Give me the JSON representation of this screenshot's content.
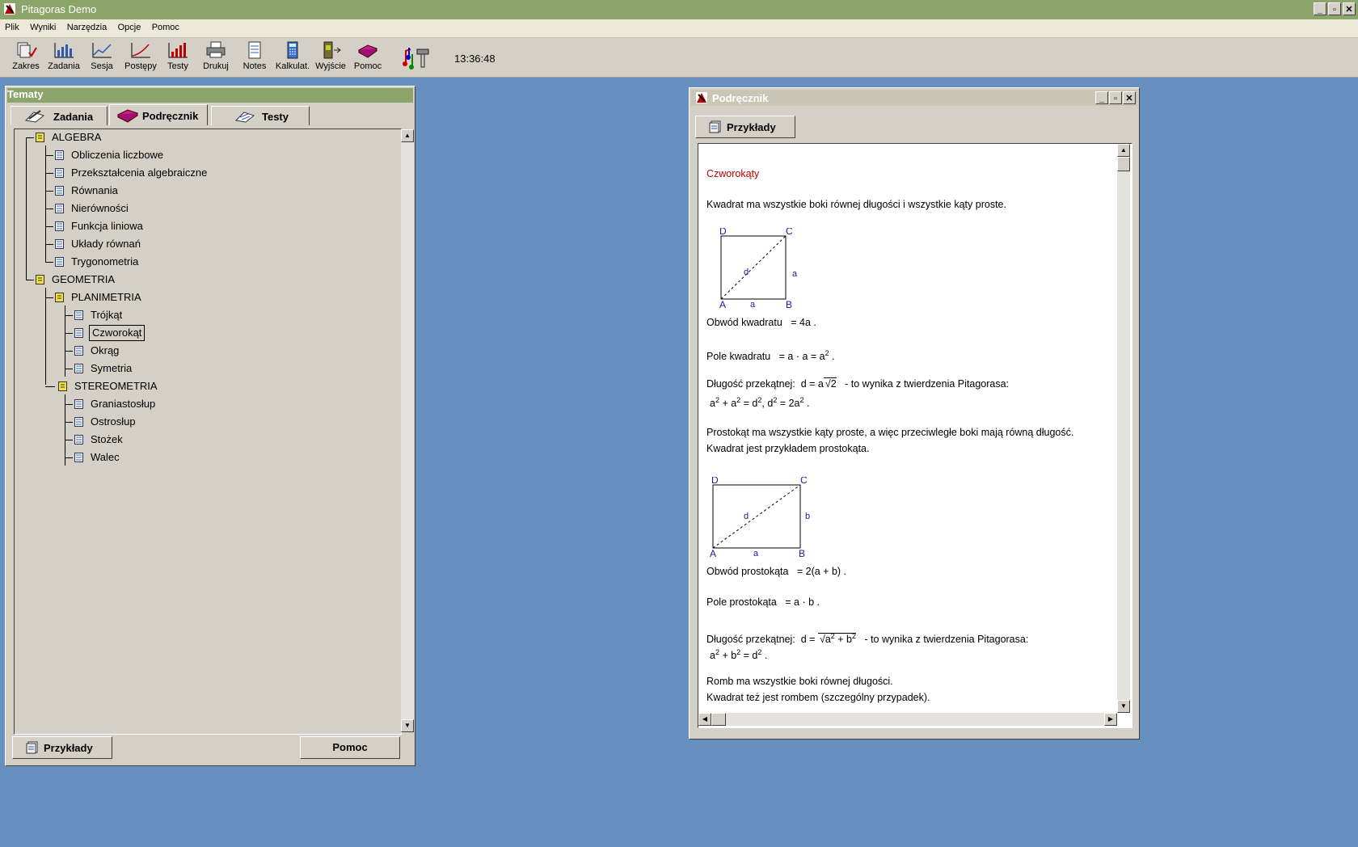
{
  "app": {
    "title": "Pitagoras Demo",
    "window_controls": [
      "_",
      "▫",
      "✕"
    ]
  },
  "menu": [
    "Plik",
    "Wyniki",
    "Narzędzia",
    "Opcje",
    "Pomoc"
  ],
  "toolbar": {
    "buttons": [
      {
        "label": "Zakres",
        "icon": "scope-icon"
      },
      {
        "label": "Zadania",
        "icon": "tasks-bar-chart-icon"
      },
      {
        "label": "Sesja",
        "icon": "session-line-chart-icon"
      },
      {
        "label": "Postępy",
        "icon": "progress-chart-icon"
      },
      {
        "label": "Testy",
        "icon": "tests-bar-chart-icon"
      },
      {
        "label": "Drukuj",
        "icon": "printer-icon"
      },
      {
        "label": "Notes",
        "icon": "notepad-icon"
      },
      {
        "label": "Kalkulat.",
        "icon": "calculator-icon"
      },
      {
        "label": "Wyjście",
        "icon": "exit-door-icon"
      },
      {
        "label": "Pomoc",
        "icon": "help-book-icon"
      }
    ],
    "clock": "13:36:48"
  },
  "tematy": {
    "title": "Tematy",
    "tabs": [
      "Zadania",
      "Podręcznik",
      "Testy"
    ],
    "active_tab": "Podręcznik",
    "tree": {
      "algebra": "ALGEBRA",
      "algebra_items": [
        "Obliczenia liczbowe",
        "Przekształcenia algebraiczne",
        "Równania",
        "Nierówności",
        "Funkcja liniowa",
        "Układy równań",
        "Trygonometria"
      ],
      "geometria": "GEOMETRIA",
      "planimetria": "PLANIMETRIA",
      "planimetria_items": [
        "Trójkąt",
        "Czworokąt",
        "Okrąg",
        "Symetria"
      ],
      "stereometria": "STEREOMETRIA",
      "stereometria_items": [
        "Graniastosłup",
        "Ostrosłup",
        "Stożek",
        "Walec"
      ],
      "selected": "Czworokąt"
    },
    "buttons": {
      "examples": "Przykłady",
      "help": "Pomoc"
    }
  },
  "podrecznik": {
    "title": "Podręcznik",
    "examples_button": "Przykłady",
    "heading": "Czworokąty",
    "p1": "Kwadrat ma wszystkie boki równej długości i wszystkie kąty proste.",
    "square_labels": {
      "D": "D",
      "C": "C",
      "A": "A",
      "B": "B",
      "d": "d",
      "a_side": "a",
      "a_bottom": "a"
    },
    "obwod_kw_label": "Obwód kwadratu",
    "obwod_kw_formula": "= 4a .",
    "pole_kw_label": "Pole kwadratu",
    "pole_kw_formula_a": "= a · a = a",
    "pole_kw_formula_exp": "2",
    "pole_kw_formula_end": " .",
    "diag_label": "Długość przekątnej:",
    "diag_kw_formula": "d = a",
    "diag_kw_root": "2",
    "diag_kw_suffix": "- to wynika z twierdzenia Pitagorasa:",
    "diag_kw_eq": [
      "a",
      "2",
      " + a",
      "2",
      " = d",
      "2",
      ",    d",
      "2",
      " = 2a",
      "2",
      " ."
    ],
    "p2a": "Prostokąt ma wszystkie kąty proste, a więc przeciwległe boki mają równą długość.",
    "p2b": "Kwadrat jest przykładem prostokąta.",
    "rect_labels": {
      "D": "D",
      "C": "C",
      "A": "A",
      "B": "B",
      "d": "d",
      "b": "b",
      "a": "a"
    },
    "obwod_pr_label": "Obwód prostokąta",
    "obwod_pr_formula": "= 2(a + b) .",
    "pole_pr_label": "Pole prostokąta",
    "pole_pr_formula": "= a · b .",
    "diag_pr_formula": "d =",
    "diag_pr_root": [
      "a",
      "2",
      " + b",
      "2"
    ],
    "diag_pr_suffix": "- to wynika z twierdzenia Pitagorasa:",
    "diag_pr_eq": [
      "a",
      "2",
      " + b",
      "2",
      " = d",
      "2",
      " ."
    ],
    "p3a": "Romb ma wszystkie boki równej długości.",
    "p3b": "Kwadrat też jest rombem (szczególny przypadek)."
  },
  "colors": {
    "desktop": "#6590bf",
    "titlebar_active": "#8ba56b",
    "titlebar_inactive": "#c9c6b6",
    "accent_red": "#c00000",
    "label_blue": "#1a1aa6"
  }
}
